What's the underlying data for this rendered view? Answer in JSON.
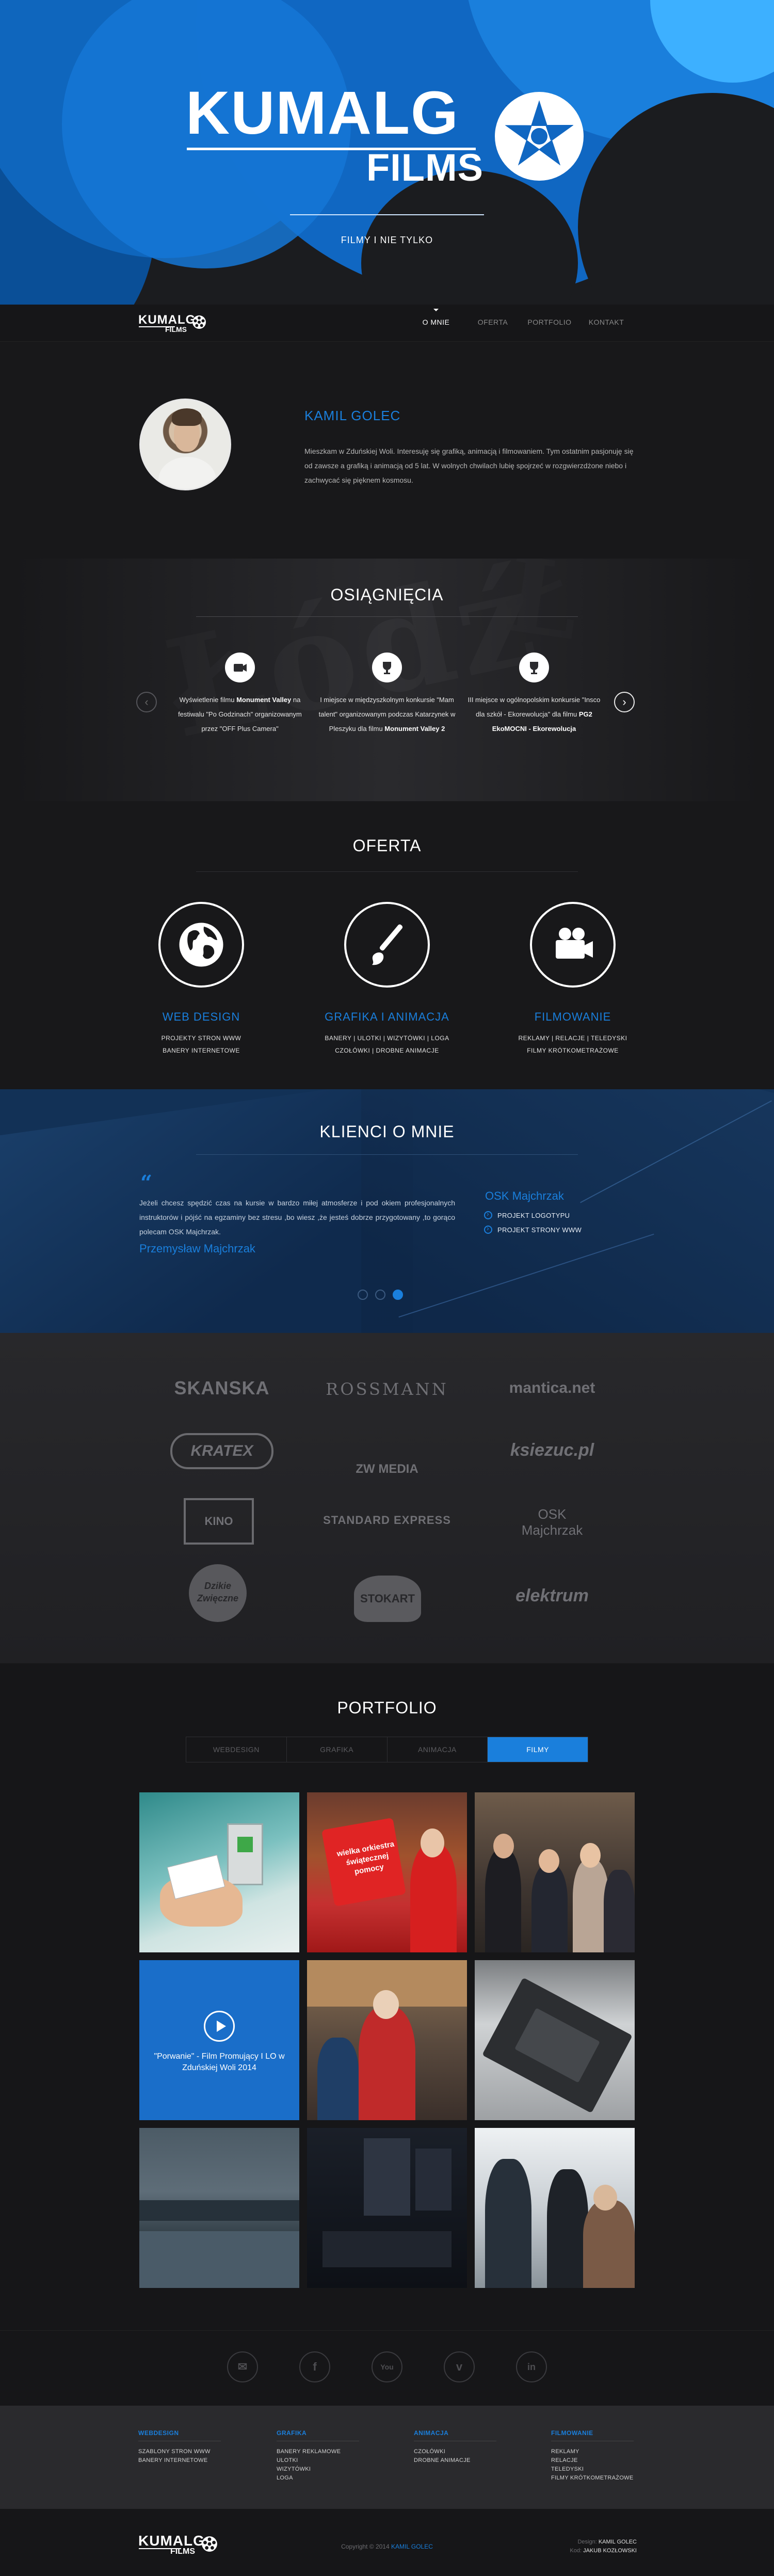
{
  "hero": {
    "brand_top": "KUMALG",
    "brand_bottom": "FILMS",
    "tagline": "FILMY I NIE TYLKO"
  },
  "nav": {
    "logo_top": "KUMALG",
    "logo_bottom": "FILMS",
    "items": [
      {
        "label": "O MNIE",
        "active": true
      },
      {
        "label": "OFERTA",
        "active": false
      },
      {
        "label": "PORTFOLIO",
        "active": false
      },
      {
        "label": "KONTAKT",
        "active": false
      }
    ]
  },
  "about": {
    "name": "KAMIL GOLEC",
    "bio": "Mieszkam w Zduńskiej Woli. Interesuję się grafiką, animacją i filmowaniem. Tym ostatnim pasjonuję się od zawsze a  grafiką i animacją od 5 lat. W wolnych chwilach lubię spojrzeć w rozgwierzdżone niebo i zachwycać się pięknem kosmosu."
  },
  "achievements": {
    "title": "OSIĄGNIĘCIA",
    "items": [
      {
        "icon": "film-icon",
        "parts": [
          "Wyświetlenie filmu ",
          "Monument Valley",
          " na festiwalu \"Po Godzinach\" organizowanym przez \"OFF Plus Camera\""
        ]
      },
      {
        "icon": "trophy-icon",
        "parts": [
          "I miejsce w międzyszkolnym konkursie \"Mam talent\" organizowanym podczas Katarzynek w Pleszyku dla filmu ",
          "Monument Valley 2",
          ""
        ]
      },
      {
        "icon": "trophy-icon",
        "parts": [
          "III miejsce w ogólnopolskim konkursie \"Insco dla szkół - Ekorewolucja\" dla filmu ",
          "PG2 EkoMOCNI - Ekorewolucja",
          ""
        ]
      }
    ]
  },
  "offer": {
    "title": "OFERTA",
    "items": [
      {
        "icon": "globe-icon",
        "title": "WEB DESIGN",
        "desc": [
          "PROJEKTY STRON WWW",
          "BANERY INTERNETOWE"
        ]
      },
      {
        "icon": "brush-icon",
        "title": "GRAFIKA I ANIMACJA",
        "desc": [
          "BANERY | ULOTKI | WIZYTÓWKI | LOGA",
          "CZOŁÓWKI | DROBNE ANIMACJE"
        ]
      },
      {
        "icon": "camera-icon",
        "title": "FILMOWANIE",
        "desc": [
          "REKLAMY | RELACJE | TELEDYSKI",
          "FILMY KRÓTKOMETRAŻOWE"
        ]
      }
    ]
  },
  "testimonials": {
    "title": "KLIENCI O MNIE",
    "quote": "Jeżeli chcesz spędzić czas na kursie w bardzo miłej atmosferze i pod okiem profesjonalnych instruktorów i pójść na egzaminy bez stresu ,bo wiesz ,że jesteś dobrze przygotowany ,to gorąco polecam OSK Majchrzak.",
    "author": "Przemysław Majchrzak",
    "client": "OSK Majchrzak",
    "projects": [
      "PROJEKT LOGOTYPU",
      "PROJEKT STRONY WWW"
    ],
    "active_slide": 3,
    "slides": 3
  },
  "clients": {
    "logos": [
      "SKANSKA",
      "ROSSMANN",
      "mantica.net",
      "KRATEX",
      "ZW MEDIA",
      "ksiezuc.pl",
      "KINO",
      "STANDARD EXPRESS",
      "OSK Majchrzak",
      "Dzikie Zwięczne",
      "STOKART",
      "elektrum"
    ]
  },
  "portfolio": {
    "title": "PORTFOLIO",
    "tabs": [
      {
        "label": "WEBDESIGN",
        "active": false
      },
      {
        "label": "GRAFIKA",
        "active": false
      },
      {
        "label": "ANIMACJA",
        "active": false
      },
      {
        "label": "FILMY",
        "active": true
      }
    ],
    "featured_label": "\"Porwanie\" - Film Promujący I LO w Zduńskiej Woli 2014",
    "sign_text": [
      "wielka orkiestra",
      "świątecznej",
      "pomocy"
    ]
  },
  "social": [
    "mail-icon",
    "facebook-icon",
    "youtube-icon",
    "vimeo-icon",
    "linkedin-icon"
  ],
  "footer": {
    "columns": [
      {
        "title": "WEBDESIGN",
        "items": [
          "SZABLONY STRON WWW",
          "BANERY INTERNETOWE"
        ]
      },
      {
        "title": "GRAFIKA",
        "items": [
          "BANERY REKLAMOWE",
          "ULOTKI",
          "WIZYTÓWKI",
          "LOGA"
        ]
      },
      {
        "title": "ANIMACJA",
        "items": [
          "CZOŁÓWKI",
          "DROBNE ANIMACJE"
        ]
      },
      {
        "title": "FILMOWANIE",
        "items": [
          "REKLAMY",
          "RELACJE",
          "TELEDYSKI",
          "FILMY KRÓTKOMETRAŻOWE"
        ]
      }
    ],
    "copyright_prefix": "Copyright © 2014",
    "copyright_name": "KAMIL GOLEC",
    "design_label": "Design:",
    "design_name": "KAMIL GOLEC",
    "code_label": "Kod:",
    "code_name": "JAKUB KOZŁOWSKI"
  }
}
